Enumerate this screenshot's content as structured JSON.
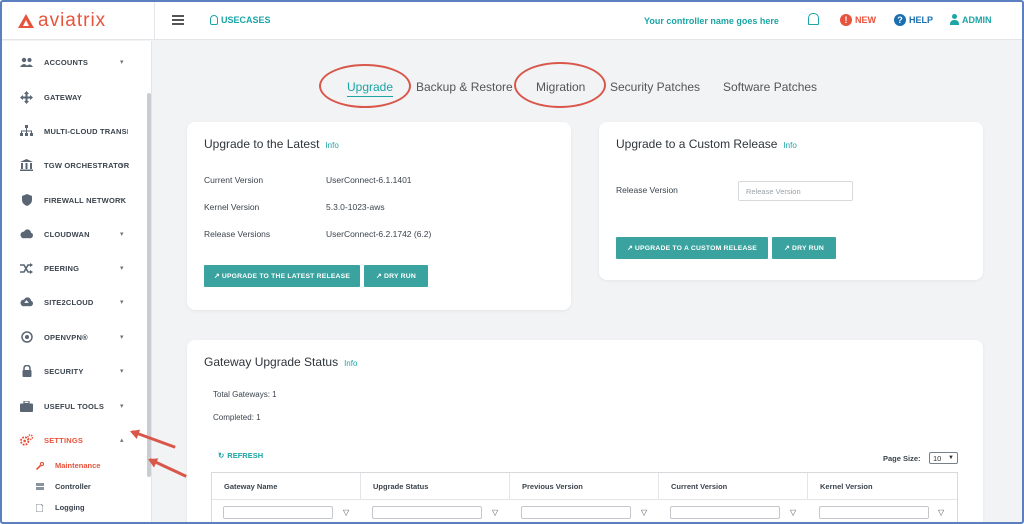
{
  "brand": {
    "name": "aviatrix",
    "color": "#e8533b",
    "accent": "#1ba5a5"
  },
  "topbar": {
    "usecases": "USECASES",
    "controller_name": "Your controller name goes here",
    "new_label": "NEW",
    "help_label": "HELP",
    "admin_label": "ADMIN"
  },
  "sidebar": {
    "items": [
      {
        "label": "ACCOUNTS",
        "icon": "users-icon",
        "caret": true
      },
      {
        "label": "GATEWAY",
        "icon": "arrows-move-icon",
        "caret": false
      },
      {
        "label": "MULTI-CLOUD TRANSIT",
        "icon": "network-icon",
        "caret": false
      },
      {
        "label": "TGW ORCHESTRATOR",
        "icon": "bank-icon",
        "caret": true
      },
      {
        "label": "FIREWALL NETWORK",
        "icon": "shield-icon",
        "caret": true
      },
      {
        "label": "CLOUDWAN",
        "icon": "cloud-icon",
        "caret": true
      },
      {
        "label": "PEERING",
        "icon": "shuffle-icon",
        "caret": true
      },
      {
        "label": "SITE2CLOUD",
        "icon": "cloud-upload-icon",
        "caret": true
      },
      {
        "label": "OPENVPN®",
        "icon": "target-icon",
        "caret": true
      },
      {
        "label": "SECURITY",
        "icon": "lock-icon",
        "caret": true
      },
      {
        "label": "USEFUL TOOLS",
        "icon": "toolbox-icon",
        "caret": true
      },
      {
        "label": "SETTINGS",
        "icon": "gears-icon",
        "caret": true,
        "active": true
      }
    ],
    "sub_items": [
      {
        "label": "Maintenance",
        "icon": "wrench-icon",
        "active": true
      },
      {
        "label": "Controller",
        "icon": "server-icon"
      },
      {
        "label": "Logging",
        "icon": "file-icon"
      }
    ]
  },
  "tabs": [
    {
      "label": "Upgrade",
      "active": true
    },
    {
      "label": "Backup & Restore"
    },
    {
      "label": "Migration"
    },
    {
      "label": "Security Patches"
    },
    {
      "label": "Software Patches"
    }
  ],
  "upgrade_latest": {
    "title": "Upgrade to the Latest",
    "info": "Info",
    "rows": [
      {
        "label": "Current Version",
        "value": "UserConnect-6.1.1401"
      },
      {
        "label": "Kernel Version",
        "value": "5.3.0-1023-aws"
      },
      {
        "label": "Release Versions",
        "value": "UserConnect-6.2.1742 (6.2)"
      }
    ],
    "upgrade_button": "↗ UPGRADE TO THE LATEST RELEASE",
    "dry_run_button": "↗ DRY RUN"
  },
  "upgrade_custom": {
    "title": "Upgrade to a Custom Release",
    "info": "Info",
    "release_label": "Release Version",
    "release_placeholder": "Release Version",
    "upgrade_button": "↗ UPGRADE TO A CUSTOM RELEASE",
    "dry_run_button": "↗ DRY RUN"
  },
  "gateway_status": {
    "title": "Gateway Upgrade Status",
    "info": "Info",
    "total": "Total Gateways: 1",
    "completed": "Completed: 1",
    "refresh": "REFRESH",
    "page_size_label": "Page Size:",
    "page_size_value": "10",
    "columns": [
      "Gateway Name",
      "Upgrade Status",
      "Previous Version",
      "Current Version",
      "Kernel Version"
    ]
  }
}
